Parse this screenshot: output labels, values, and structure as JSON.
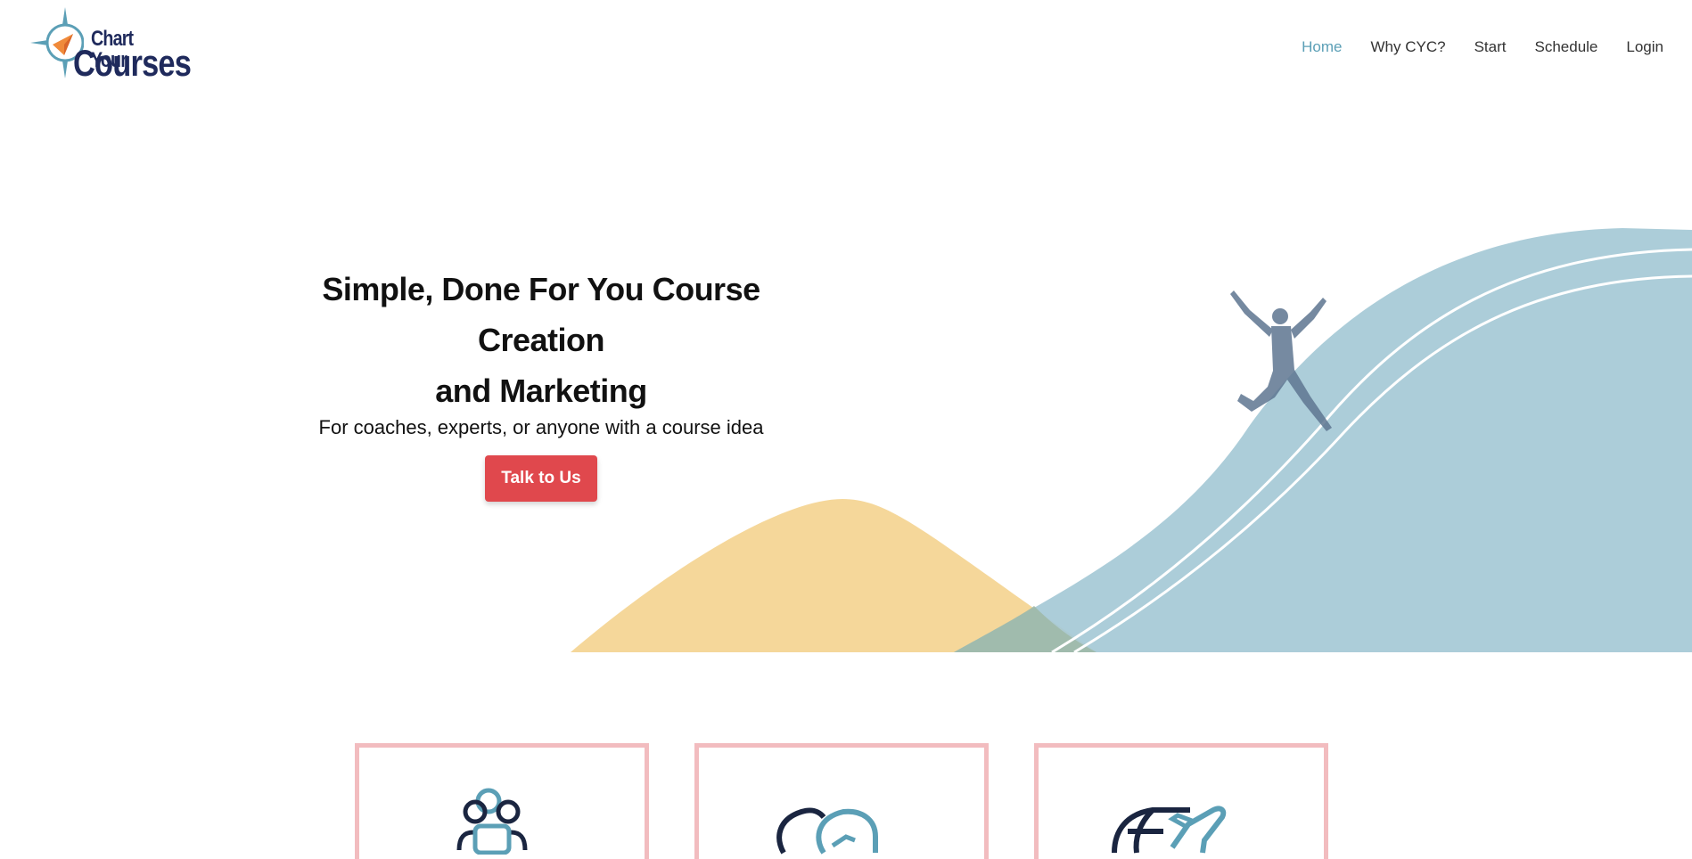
{
  "header": {
    "logo": {
      "line1": "Chart Your",
      "line2": "Courses"
    },
    "nav": [
      {
        "label": "Home",
        "active": true
      },
      {
        "label": "Why CYC?",
        "active": false
      },
      {
        "label": "Start",
        "active": false
      },
      {
        "label": "Schedule",
        "active": false
      },
      {
        "label": "Login",
        "active": false
      }
    ]
  },
  "hero": {
    "title_line1": "Simple, Done For You Course Creation",
    "title_line2": "and Marketing",
    "subtitle": "For coaches, experts, or anyone with a course idea",
    "cta_label": "Talk to Us"
  },
  "features": [
    {
      "icon": "team-icon"
    },
    {
      "icon": "handshake-icon"
    },
    {
      "icon": "globe-plane-icon"
    }
  ],
  "colors": {
    "accent": "#5b9fb6",
    "cta": "#e0484d",
    "navy": "#1f2a5c",
    "wave_blue": "#aacdd9",
    "hill_yellow": "#f4d595",
    "card_border": "#f2bcbf"
  }
}
